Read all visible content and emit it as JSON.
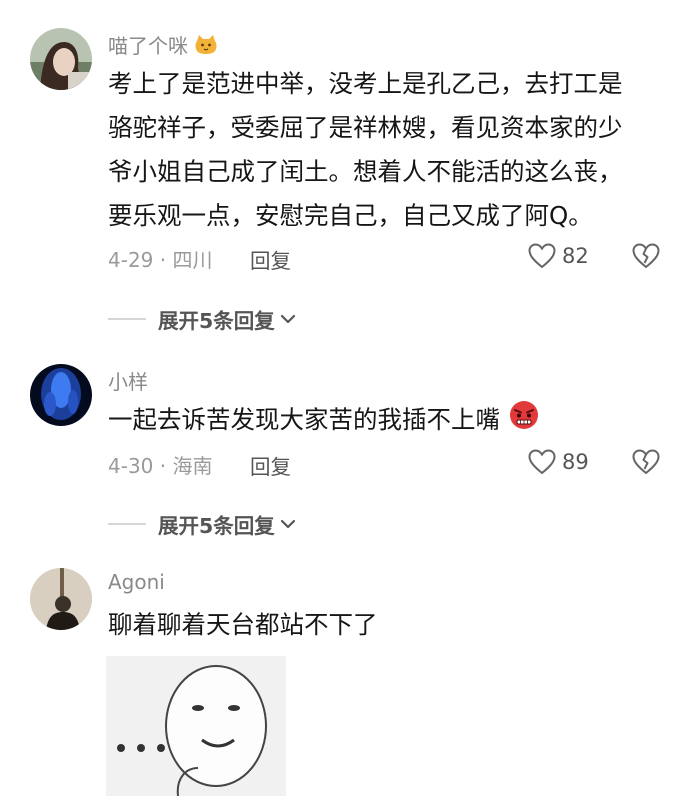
{
  "comments": [
    {
      "username": "喵了个咪",
      "text_lines": [
        "考上了是范进中举，没考上是孔乙己，去打工是",
        "骆驼祥子，受委屈了是祥林嫂，看见资本家的少",
        "爷小姐自己成了闰土。想着人不能活的这么丧，",
        "要乐观一点，安慰完自己，自己又成了阿Q。"
      ],
      "meta": "4-29 · 四川",
      "reply_label": "回复",
      "likes": "82",
      "expand_label": "展开5条回复"
    },
    {
      "username": "小样",
      "text": "一起去诉苦发现大家苦的我插不上嘴",
      "meta": "4-30 · 海南",
      "reply_label": "回复",
      "likes": "89",
      "expand_label": "展开5条回复"
    },
    {
      "username": "Agoni",
      "text": "聊着聊着天台都站不下了"
    }
  ],
  "icons": {
    "username_emoji": "cat-face-icon",
    "inline_emoji": "angry-face-icon",
    "like": "heart-outline-icon",
    "dislike": "broken-heart-icon",
    "expand": "chevron-down-icon"
  },
  "colors": {
    "text": "#161616",
    "secondary": "#8a8a8a",
    "action": "#555555",
    "cat_emoji": "#f2b23a",
    "angry_emoji": "#e23a3a"
  }
}
